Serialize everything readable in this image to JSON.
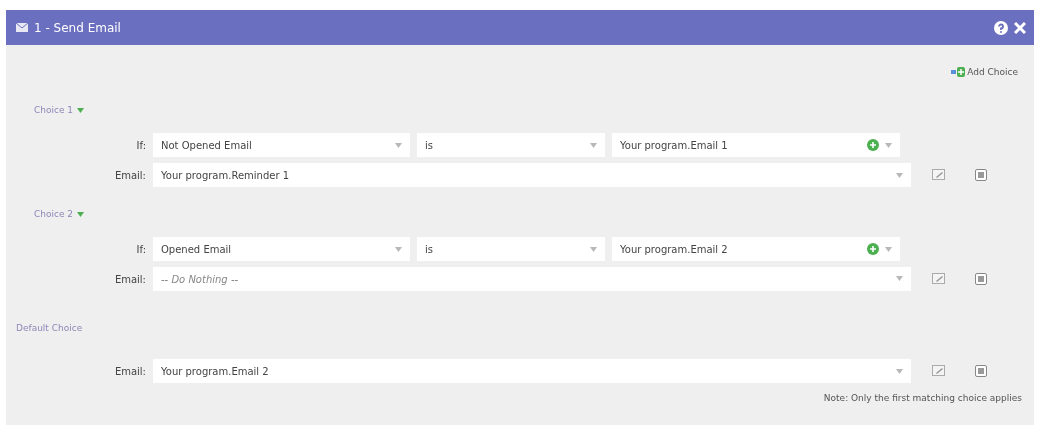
{
  "window": {
    "title": "1 - Send Email"
  },
  "add_choice": "Add Choice",
  "choices": [
    {
      "label": "Choice 1",
      "condition": {
        "label": "If:",
        "field": "Not Opened Email",
        "operator": "is",
        "value": "Your program.Email 1"
      },
      "email": {
        "label": "Email:",
        "value": "Your program.Reminder 1"
      }
    },
    {
      "label": "Choice 2",
      "condition": {
        "label": "If:",
        "field": "Opened Email",
        "operator": "is",
        "value": "Your program.Email 2"
      },
      "email": {
        "label": "Email:",
        "placeholder": "-- Do Nothing --"
      }
    }
  ],
  "default_choice": {
    "label": "Default Choice",
    "email": {
      "label": "Email:",
      "value": "Your program.Email 2"
    }
  },
  "note": "Note: Only the first matching choice applies"
}
